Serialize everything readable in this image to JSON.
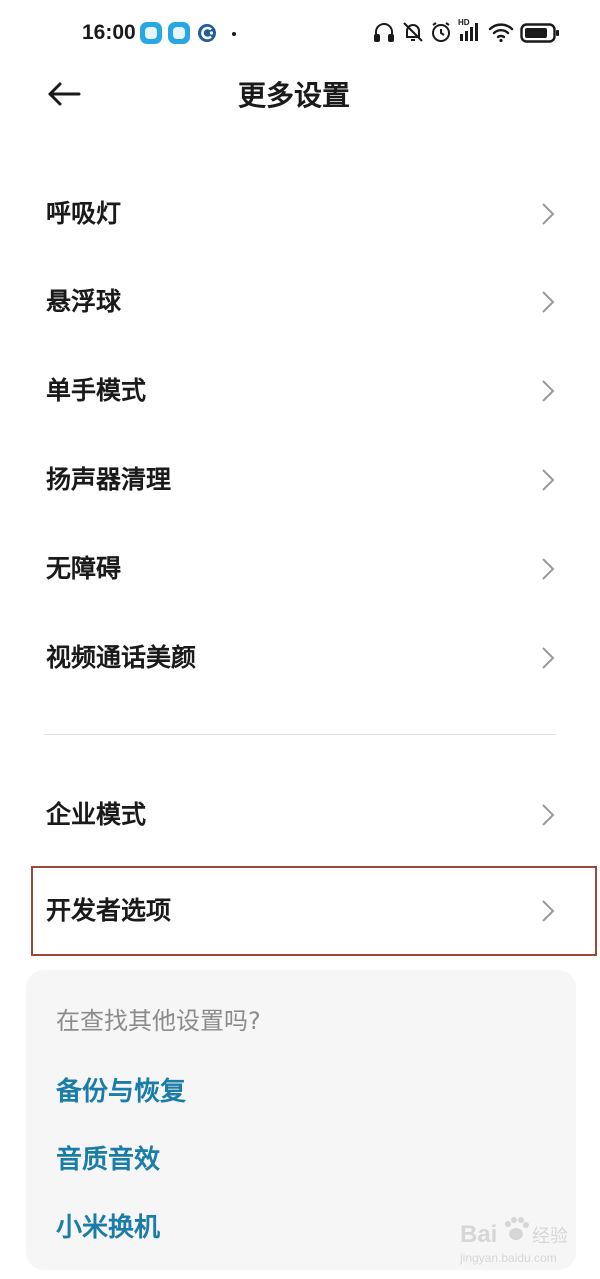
{
  "status_bar": {
    "time": "16:00",
    "hd_label": "HD",
    "icons": [
      "app-badge",
      "app-badge",
      "app-c-badge",
      "headphones-icon",
      "bell-off-icon",
      "alarm-icon",
      "signal-icon",
      "wifi-icon",
      "battery-icon"
    ]
  },
  "header": {
    "back_icon": "arrow-left-icon",
    "title": "更多设置"
  },
  "settings": {
    "group1": [
      {
        "label": "呼吸灯"
      },
      {
        "label": "悬浮球"
      },
      {
        "label": "单手模式"
      },
      {
        "label": "扬声器清理"
      },
      {
        "label": "无障碍"
      },
      {
        "label": "视频通话美颜"
      }
    ],
    "group2": [
      {
        "label": "企业模式"
      },
      {
        "label": "开发者选项",
        "highlighted": true
      }
    ]
  },
  "suggestions": {
    "heading": "在查找其他设置吗?",
    "links": [
      {
        "label": "备份与恢复"
      },
      {
        "label": "音质音效"
      },
      {
        "label": "小米换机"
      }
    ]
  },
  "watermark": {
    "brand": "Bai",
    "brand_tail": "经验",
    "url": "jingyan.baidu.com"
  },
  "colors": {
    "accent_link": "#1a7ca8",
    "highlight_border": "#9a4a3a",
    "badge_blue": "#27a8e5",
    "heading_gray": "#8b8b8b"
  }
}
